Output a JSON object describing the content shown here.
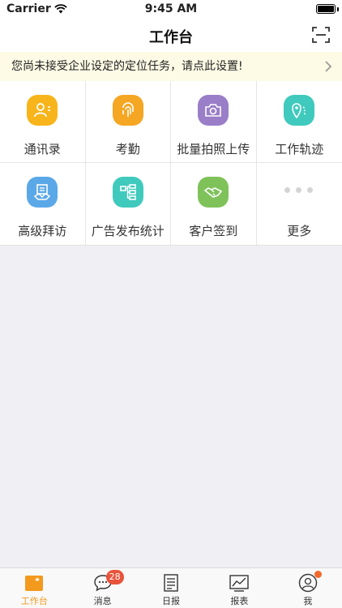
{
  "status_bar": {
    "carrier": "Carrier",
    "time": "9:45 AM"
  },
  "header": {
    "title": "工作台",
    "scan_icon": "scan-icon"
  },
  "notice": {
    "text": "您尚未接受企业设定的定位任务，请点此设置!"
  },
  "grid": {
    "items": [
      {
        "label": "通讯录",
        "icon": "contacts-icon",
        "color": "#f7b51b"
      },
      {
        "label": "考勤",
        "icon": "fingerprint-icon",
        "color": "#f5a623"
      },
      {
        "label": "批量拍照上传",
        "icon": "camera-icon",
        "color": "#9a7ec8"
      },
      {
        "label": "工作轨迹",
        "icon": "location-track-icon",
        "color": "#3fcabd"
      },
      {
        "label": "高级拜访",
        "icon": "visit-icon",
        "color": "#5aa8e8"
      },
      {
        "label": "广告发布统计",
        "icon": "flowchart-icon",
        "color": "#3fcabd"
      },
      {
        "label": "客户签到",
        "icon": "handshake-icon",
        "color": "#7fc25a"
      },
      {
        "label": "更多",
        "icon": "more-icon",
        "color": "#d4d4d4"
      }
    ]
  },
  "tab_bar": {
    "tabs": [
      {
        "label": "工作台",
        "icon": "workbench-icon",
        "active": true
      },
      {
        "label": "消息",
        "icon": "chat-icon",
        "badge": "28"
      },
      {
        "label": "日报",
        "icon": "report-doc-icon"
      },
      {
        "label": "报表",
        "icon": "chart-icon"
      },
      {
        "label": "我",
        "icon": "profile-icon",
        "dot": true
      }
    ]
  },
  "colors": {
    "accent": "#f39a1e",
    "badge": "#e8533a",
    "notice_bg": "#fdfbe5"
  }
}
